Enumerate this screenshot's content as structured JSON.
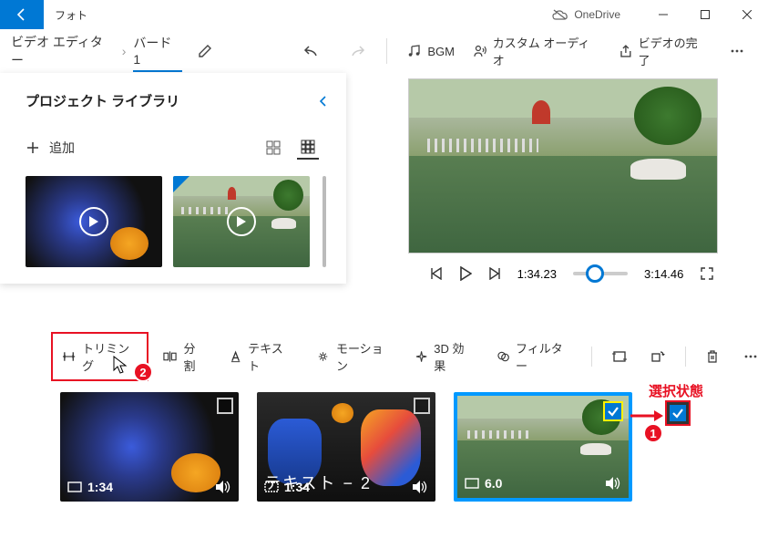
{
  "titlebar": {
    "app_name": "フォト",
    "onedrive": "OneDrive"
  },
  "breadcrumb": {
    "root": "ビデオ エディター",
    "current": "バード 1"
  },
  "topbar": {
    "bgm": "BGM",
    "custom_audio": "カスタム オーディオ",
    "finish": "ビデオの完了"
  },
  "library": {
    "title": "プロジェクト ライブラリ",
    "add": "追加"
  },
  "playback": {
    "current_time": "1:34.23",
    "total_time": "3:14.46"
  },
  "edit": {
    "trim": "トリミング",
    "split": "分割",
    "text": "テキスト",
    "motion": "モーション",
    "effects3d": "3D 効果",
    "filter": "フィルター"
  },
  "clips": [
    {
      "duration": "1:34"
    },
    {
      "duration": "1:34",
      "overlay": "テキスト − 2"
    },
    {
      "duration": "6.0"
    }
  ],
  "annotations": {
    "selected_label": "選択状態",
    "badge1": "1",
    "badge2": "2"
  }
}
